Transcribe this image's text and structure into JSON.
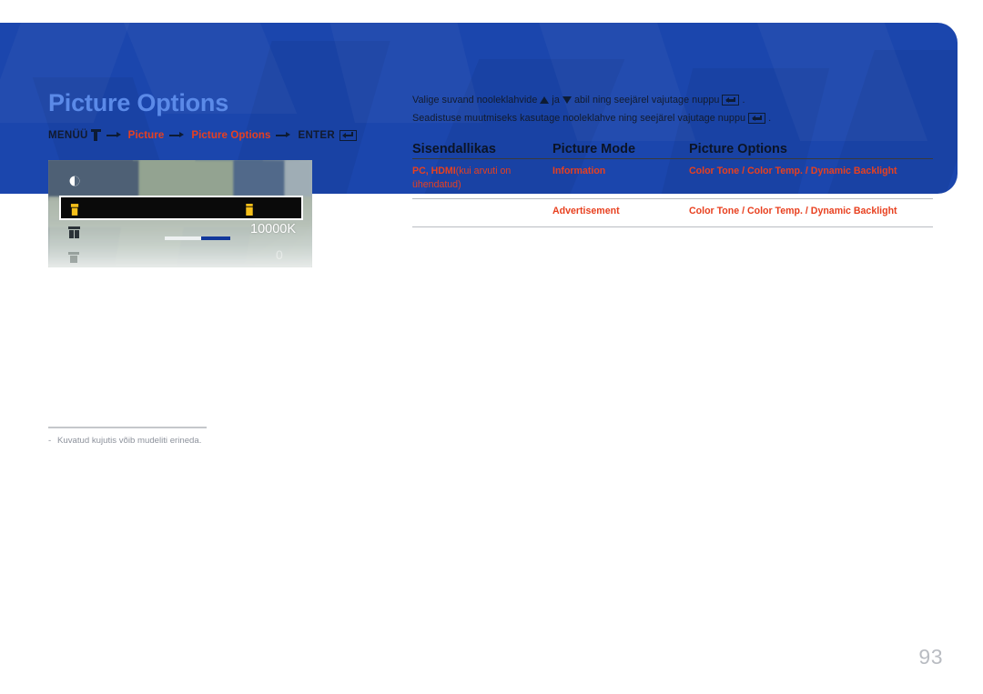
{
  "document": {
    "page_number": "93"
  },
  "header": {
    "title": "Picture Options",
    "breadcrumb": {
      "menu_label": "MENÜÜ",
      "menu_key_icon": "menu-key-icon",
      "step1": "Picture",
      "step2": "Picture Options",
      "enter_label": "ENTER",
      "enter_key_icon": "enter-key-icon",
      "arrow_icon": "arrow-right-icon"
    }
  },
  "tv_screenshot": {
    "alt": "on-screen display menu preview",
    "rows": [
      {
        "icon": "picture-mode-icon",
        "value": ""
      },
      {
        "icon": "color-tone-icon",
        "value": "",
        "selected": true,
        "right_icon": "adjust-icon"
      },
      {
        "icon": "color-temperature-icon",
        "value": "10000K",
        "slider": true
      },
      {
        "icon": "dynamic-backlight-icon",
        "value": "0"
      }
    ],
    "temperature_value": "10000K",
    "last_value": "0"
  },
  "instructions": {
    "line1_part1": "Valige suvand nooleklahvide",
    "line1_up_arrow": "up-arrow-icon",
    "line1_ja": "ja",
    "line1_down_arrow": "down-arrow-icon",
    "line1_part2": "abil ning seejärel vajutage nuppu",
    "line1_end": ".",
    "line2_part1": "Seadistuse muutmiseks kasutage nooleklahve ning seejärel vajutage nuppu",
    "line2_end": "."
  },
  "table": {
    "headers": [
      "Sisendallikas",
      "Picture Mode",
      "Picture Options"
    ],
    "rows": [
      {
        "source_bold": "PC, HDMI",
        "source_plain": "(kui arvuti on ühendatud)",
        "picture_mode": "Information",
        "picture_options": "Color Tone / Color Temp. / Dynamic Backlight"
      },
      {
        "source_bold": "",
        "source_plain": "",
        "picture_mode": "Advertisement",
        "picture_options": "Color Tone / Color Temp. / Dynamic Backlight"
      }
    ]
  },
  "footnote": {
    "dash": "-",
    "text": "Kuvatud kujutis võib mudeliti erineda."
  },
  "colors": {
    "banner_blue": "#1b46ad",
    "title_blue": "#5b8ae8",
    "accent_red": "#e8401f",
    "dark_text": "#0b1426",
    "muted_gray": "#8d929c",
    "highlight_yellow": "#f5bf1a"
  }
}
